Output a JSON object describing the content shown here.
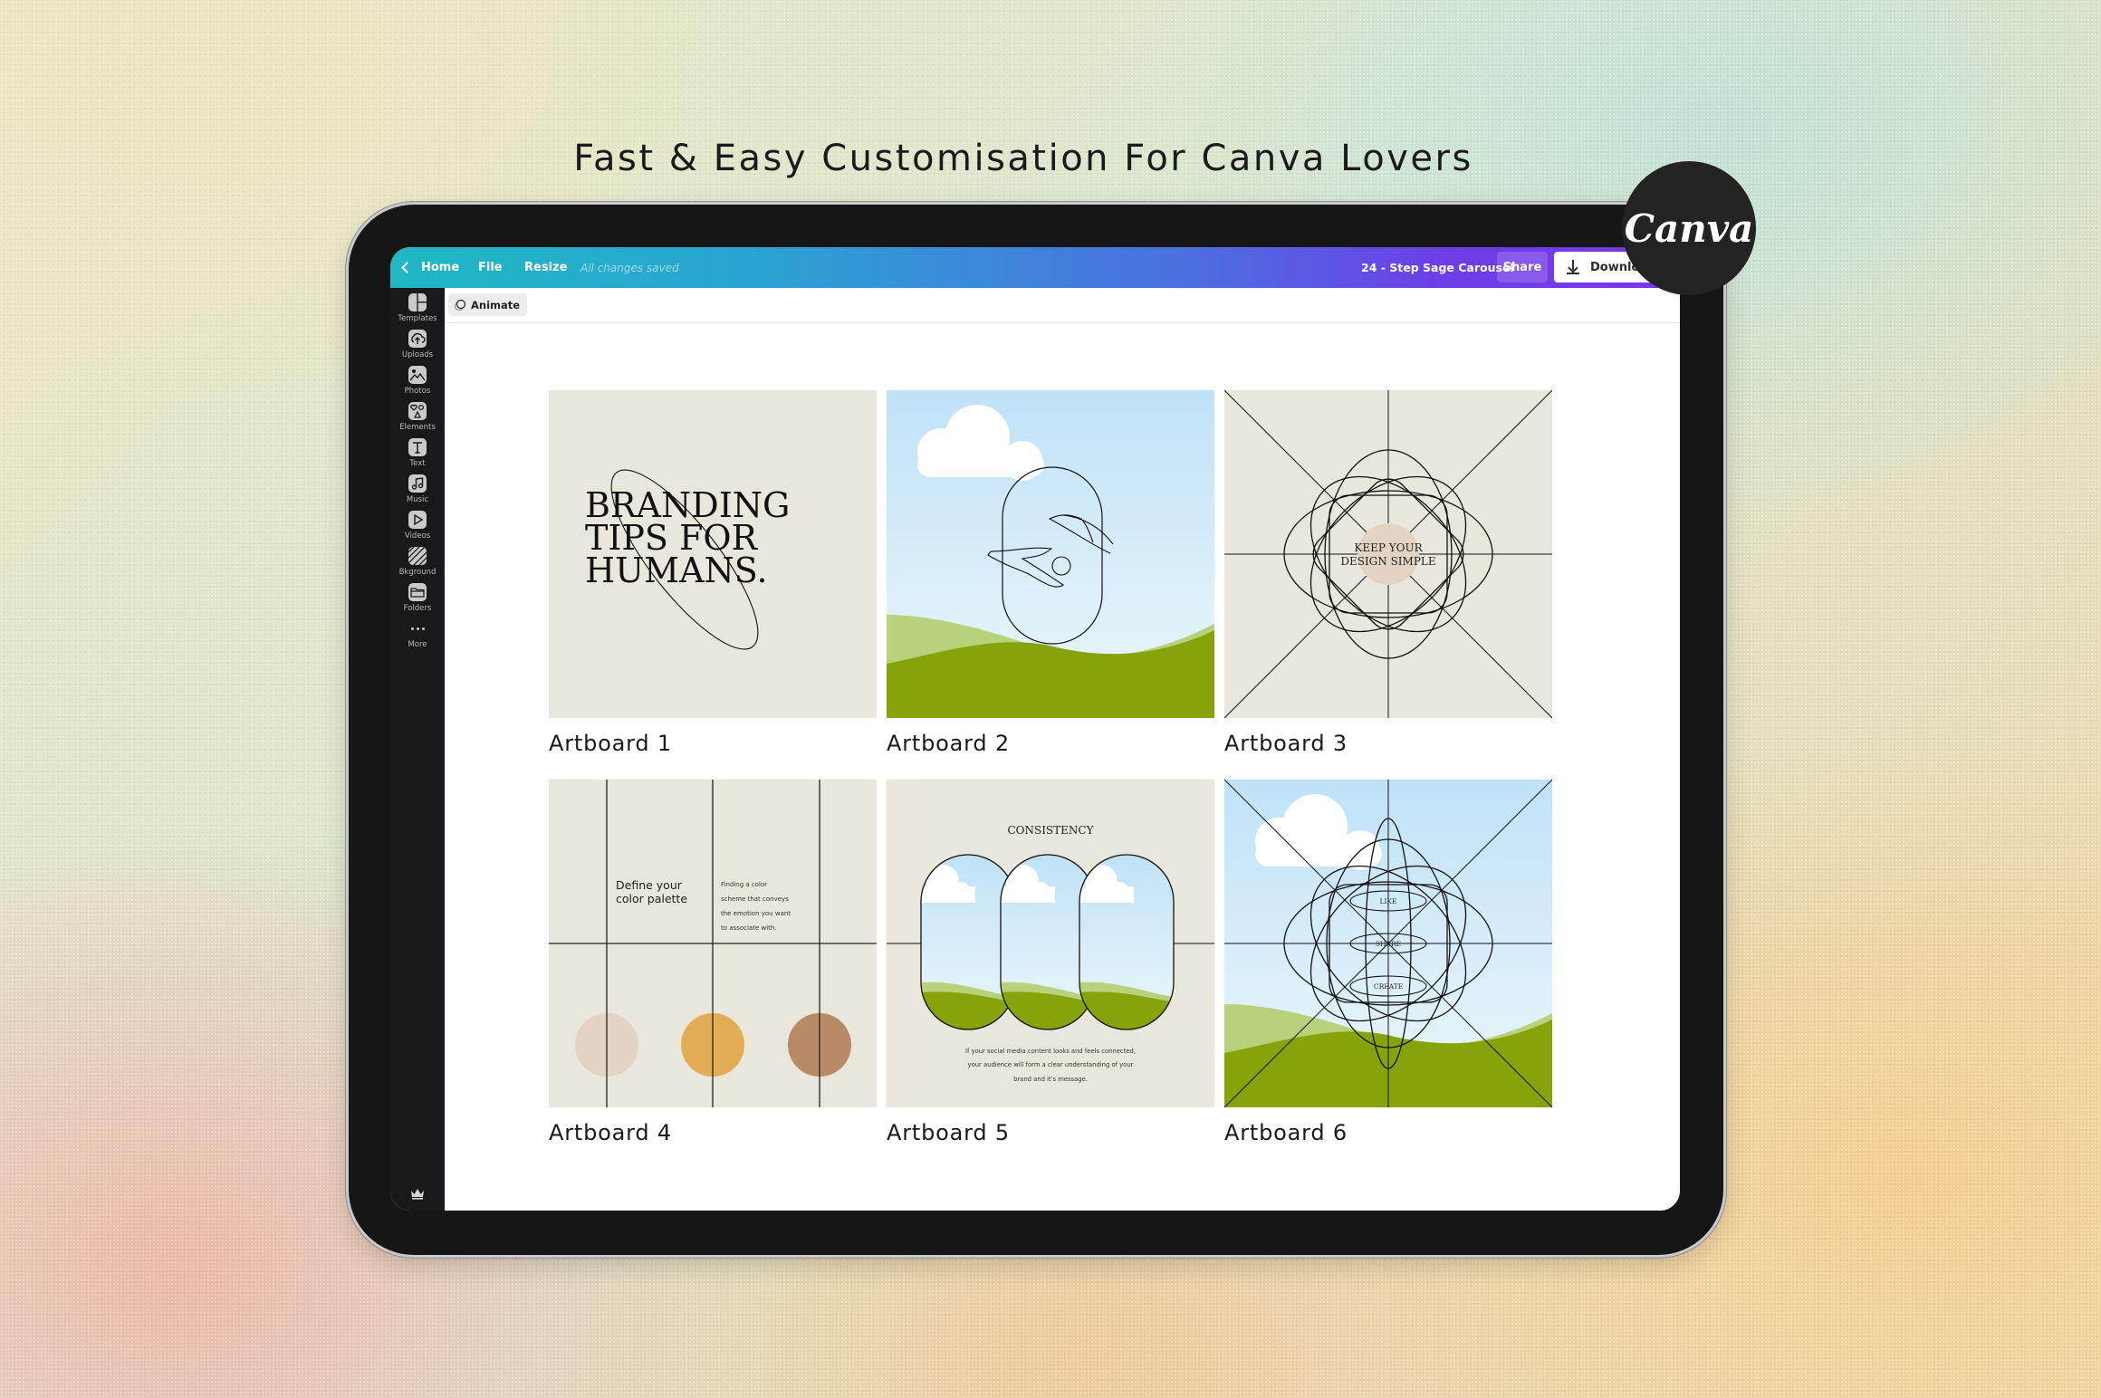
{
  "headline": "Fast & Easy Customisation For Canva Lovers",
  "badge": {
    "label": "Canva",
    "icon": "canva-logo"
  },
  "app": {
    "topbar": {
      "home_label": "Home",
      "file_label": "File",
      "resize_label": "Resize",
      "save_status": "All changes saved",
      "document_title": "24 - Step Sage Carousel",
      "share_label": "Share",
      "download_label": "Download"
    },
    "toolbar": {
      "animate_label": "Animate"
    },
    "sidebar": {
      "items": [
        {
          "label": "Templates",
          "icon": "templates-icon"
        },
        {
          "label": "Uploads",
          "icon": "upload-cloud-icon"
        },
        {
          "label": "Photos",
          "icon": "photo-icon"
        },
        {
          "label": "Elements",
          "icon": "shapes-icon"
        },
        {
          "label": "Text",
          "icon": "text-icon"
        },
        {
          "label": "Music",
          "icon": "music-note-icon"
        },
        {
          "label": "Videos",
          "icon": "play-icon"
        },
        {
          "label": "Bkground",
          "icon": "background-hatch-icon"
        },
        {
          "label": "Folders",
          "icon": "folder-icon"
        },
        {
          "label": "More",
          "icon": "more-dots-icon"
        }
      ],
      "footer_icon": "crown-icon"
    },
    "artboards": [
      {
        "label": "Artboard 1",
        "title_lines": [
          "BRANDING",
          "TIPS FOR",
          "HUMANS."
        ]
      },
      {
        "label": "Artboard 2"
      },
      {
        "label": "Artboard 3",
        "text_lines": [
          "KEEP YOUR",
          "DESIGN SIMPLE"
        ]
      },
      {
        "label": "Artboard 4",
        "heading_lines": [
          "Define your",
          "color palette"
        ],
        "body_lines": [
          "Finding a color",
          "scheme that conveys",
          "the emotion you want",
          "to associate with."
        ],
        "swatches": [
          "#e2d3c4",
          "#e2ad55",
          "#b98a66"
        ]
      },
      {
        "label": "Artboard 5",
        "heading": "CONSISTENCY",
        "body_lines": [
          "If your social media content looks and feels connected,",
          "your audience will form a clear understanding of your",
          "brand and it's message."
        ]
      },
      {
        "label": "Artboard 6",
        "pills": [
          "LIKE",
          "SHARE",
          "CREATE"
        ]
      }
    ]
  },
  "colors": {
    "paper": "#e9e6db",
    "sky_top": "#bfe2f7",
    "sky_bottom": "#eaf5fb",
    "grass": "#86a40a",
    "grass_light": "#b7d27a",
    "blush": "#e3d3c5"
  }
}
